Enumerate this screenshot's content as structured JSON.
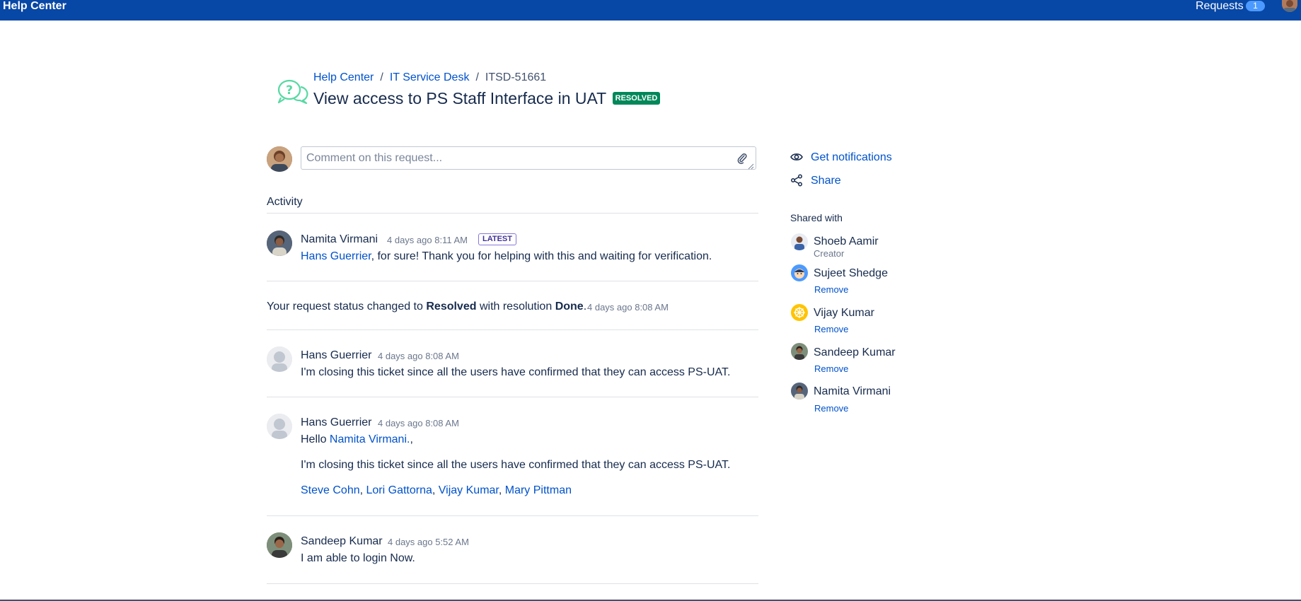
{
  "topbar": {
    "brand": "Help Center",
    "requests_label": "Requests",
    "requests_count": "1"
  },
  "header": {
    "breadcrumb": [
      "Help Center",
      "IT Service Desk",
      "ITSD-51661"
    ],
    "breadcrumb_sep": "/",
    "title": "View access to PS Staff Interface in UAT",
    "status": "RESOLVED"
  },
  "comment": {
    "placeholder": "Comment on this request..."
  },
  "activity": {
    "heading": "Activity",
    "entries": [
      {
        "name": "Namita Virmani",
        "time": "4 days ago 8:11 AM",
        "badge": "LATEST",
        "mention": "Hans Guerrier",
        "text": ", for sure! Thank you for helping with this and waiting for verification."
      },
      {
        "status_prefix": "Your request status changed to",
        "status_value": "Resolved",
        "status_mid": "with resolution",
        "resolution": "Done",
        "status_suffix": ".",
        "time": "4 days ago 8:08 AM"
      },
      {
        "name": "Hans Guerrier",
        "time": "4 days ago 8:08 AM",
        "text": "I'm closing this ticket since all the users have confirmed that they can access PS-UAT."
      },
      {
        "name": "Hans Guerrier",
        "time": "4 days ago 8:08 AM",
        "hello": "Hello",
        "mention": "Namita Virmani.",
        "mention_suffix": ",",
        "text": "I'm closing this ticket since all the users have confirmed that they can access PS-UAT.",
        "cc": [
          "Steve Cohn",
          "Lori Gattorna",
          "Vijay Kumar",
          "Mary Pittman"
        ]
      },
      {
        "name": "Sandeep Kumar",
        "time": "4 days ago 5:52 AM",
        "text": "I am able to login Now."
      }
    ]
  },
  "sidebar": {
    "notifications": "Get notifications",
    "share": "Share",
    "shared_with_heading": "Shared with",
    "people": [
      {
        "name": "Shoeb Aamir",
        "role": "Creator"
      },
      {
        "name": "Sujeet Shedge",
        "action": "Remove"
      },
      {
        "name": "Vijay Kumar",
        "action": "Remove"
      },
      {
        "name": "Sandeep Kumar",
        "action": "Remove"
      },
      {
        "name": "Namita Virmani",
        "action": "Remove"
      }
    ]
  },
  "colors": {
    "topbar": "#0747a6",
    "link": "#0052cc",
    "resolved": "#00875a",
    "latest_border": "#8777d9"
  },
  "icons": [
    "help-chat-icon",
    "paperclip-icon",
    "eye-icon",
    "share-icon",
    "default-avatar-icon"
  ]
}
